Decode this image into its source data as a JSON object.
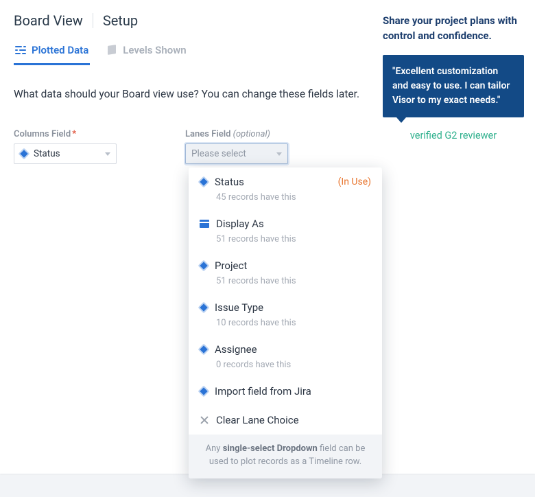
{
  "breadcrumb": {
    "view": "Board View",
    "page": "Setup"
  },
  "tabs": {
    "plotted": "Plotted Data",
    "levels": "Levels Shown"
  },
  "prompt": "What data should your Board view use? You can change these fields later.",
  "columnsField": {
    "label": "Columns Field",
    "required": "*",
    "value": "Status"
  },
  "lanesField": {
    "label": "Lanes Field",
    "optional": "(optional)",
    "placeholder": "Please select"
  },
  "dropdown": {
    "options": [
      {
        "name": "Status",
        "sub": "45 records have this",
        "tag": "(In Use)",
        "icon": "diamond"
      },
      {
        "name": "Display As",
        "sub": "51 records have this",
        "tag": "",
        "icon": "card"
      },
      {
        "name": "Project",
        "sub": "51 records have this",
        "tag": "",
        "icon": "diamond"
      },
      {
        "name": "Issue Type",
        "sub": "10 records have this",
        "tag": "",
        "icon": "diamond"
      },
      {
        "name": "Assignee",
        "sub": "0 records have this",
        "tag": "",
        "icon": "diamond"
      }
    ],
    "actions": {
      "import": "Import field from Jira",
      "clear": "Clear Lane Choice"
    },
    "footer_pre": "Any ",
    "footer_bold": "single-select Dropdown",
    "footer_post": " field can be used to plot records as a Timeline row."
  },
  "sidebar": {
    "headline": "Share your project plans with control and confidence.",
    "quote": "\"Excellent customization and easy to use. I can tailor Visor to my exact needs.\"",
    "reviewer": "verified G2 reviewer"
  }
}
